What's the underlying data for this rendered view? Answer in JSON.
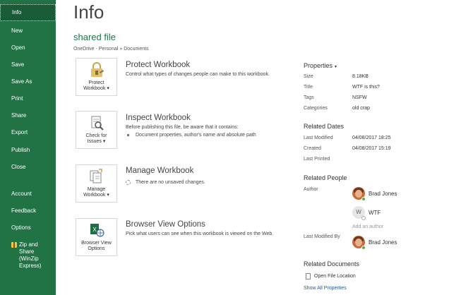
{
  "sidebar": {
    "items": [
      {
        "label": "Info"
      },
      {
        "label": "New"
      },
      {
        "label": "Open"
      },
      {
        "label": "Save"
      },
      {
        "label": "Save As"
      },
      {
        "label": "Print"
      },
      {
        "label": "Share"
      },
      {
        "label": "Export"
      },
      {
        "label": "Publish"
      },
      {
        "label": "Close"
      },
      {
        "label": "Account"
      },
      {
        "label": "Feedback"
      },
      {
        "label": "Options"
      },
      {
        "label": "Zip and\nShare\n(WinZip\nExpress)"
      }
    ]
  },
  "main": {
    "title": "Info",
    "file_name": "shared file",
    "breadcrumb": "OneDrive - Personal » Documents",
    "sections": [
      {
        "button_label": "Protect\nWorkbook ▾",
        "title": "Protect Workbook",
        "description": "Control what types of changes people can make to this workbook."
      },
      {
        "button_label": "Check for\nIssues ▾",
        "title": "Inspect Workbook",
        "description": "Before publishing this file, be aware that it contains:",
        "bullet": "Document properties, author's name and absolute path"
      },
      {
        "button_label": "Manage\nWorkbook ▾",
        "title": "Manage Workbook",
        "description": "There are no unsaved changes."
      },
      {
        "button_label": "Browser View\nOptions",
        "title": "Browser View Options",
        "description": "Pick what users can see when this workbook is viewed on the Web."
      }
    ]
  },
  "properties": {
    "heading": "Properties",
    "caret": "▾",
    "rows": [
      {
        "label": "Size",
        "value": "8.18KB"
      },
      {
        "label": "Title",
        "value": "WTF is this?"
      },
      {
        "label": "Tags",
        "value": "NSFW"
      },
      {
        "label": "Categories",
        "value": "old crap"
      }
    ]
  },
  "related_dates": {
    "heading": "Related Dates",
    "rows": [
      {
        "label": "Last Modified",
        "value": "04/08/2017 18:25"
      },
      {
        "label": "Created",
        "value": "04/08/2017 15:19"
      },
      {
        "label": "Last Printed",
        "value": ""
      }
    ]
  },
  "related_people": {
    "heading": "Related People",
    "author_label": "Author",
    "authors": [
      {
        "name": "Brad Jones",
        "initial": ""
      },
      {
        "name": "WTF",
        "initial": "W"
      }
    ],
    "add_author": "Add an author",
    "last_modified_label": "Last Modified By",
    "last_modified_by": "Brad Jones"
  },
  "related_documents": {
    "heading": "Related Documents",
    "open_location": "Open File Location",
    "show_all": "Show All Properties"
  },
  "colors": {
    "sidebar": "#217346",
    "accent": "#217346",
    "link": "#2b5797"
  }
}
